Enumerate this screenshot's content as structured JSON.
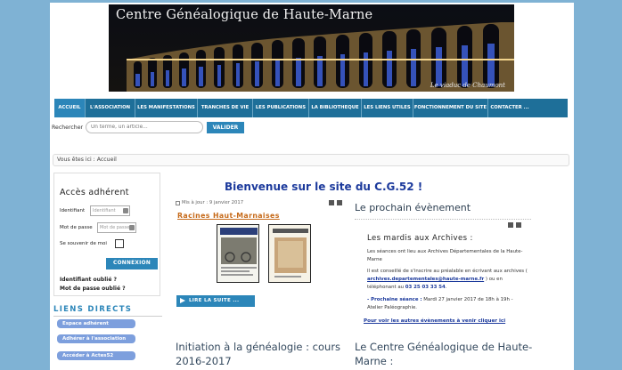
{
  "banner": {
    "title": "Centre Généalogique de Haute-Marne",
    "caption": "Le viaduc de Chaumont"
  },
  "nav": {
    "items": [
      {
        "label": "ACCUEIL",
        "active": true
      },
      {
        "label": "L'ASSOCIATION",
        "active": false
      },
      {
        "label": "LES MANIFESTATIONS",
        "active": false
      },
      {
        "label": "TRANCHES DE VIE",
        "active": false
      },
      {
        "label": "LES PUBLICATIONS",
        "active": false
      },
      {
        "label": "LA BIBLIOTHEQUE",
        "active": false
      },
      {
        "label": "LES LIENS UTILES",
        "active": false
      },
      {
        "label": "FONCTIONNEMENT DU SITE",
        "active": false
      },
      {
        "label": "CONTACTER ...",
        "active": false
      }
    ]
  },
  "search": {
    "label": "Rechercher",
    "placeholder": "Un terme, un article...",
    "button": "VALIDER"
  },
  "breadcrumb": "Vous êtes ici : Accueil",
  "login": {
    "title": "Accès adhérent",
    "id_label": "Identifiant",
    "id_placeholder": "Identifiant",
    "pass_label": "Mot de passe",
    "pass_placeholder": "Mot de passe",
    "remember_label": "Se souvenir de moi",
    "connect": "CONNEXION",
    "forgot_id": "Identifiant oublié ?",
    "forgot_pass": "Mot de passe oublié ?"
  },
  "liens": {
    "title": "LIENS DIRECTS",
    "items": [
      "Espace adhérent",
      "Adhérer à l'association",
      "Accéder à Actes52"
    ]
  },
  "main": {
    "welcome": "Bienvenue sur le site du C.G.52 !",
    "meta": "Mis à jour : 9 janvier 2017",
    "article_link": "Racines Haut-Marnaises",
    "lire": "LIRE LA SUITE ...",
    "init_title": "Initiation à la généalogie : cours 2016-2017"
  },
  "event": {
    "section_title": "Le prochain évènement",
    "heading": "Les mardis aux Archives :",
    "p1": "Les séances ont lieu aux Archives Départementales de la Haute-Marne",
    "p2_a": "Il est conseillé de s'inscrire au préalable en écrivant aux archives ( ",
    "p2_link": "archives.departementales@haute-marne.fr",
    "p2_b": " ) ou en téléphonant au ",
    "p2_tel": "03 25 03 33 54",
    "p2_c": ".",
    "p3_label": "- Prochaine séance :",
    "p3_text": " Mardi 27 janvier 2017 de 18h à 19h - Atelier Paléographie.",
    "more": "Pour voir les autres évènements à venir cliquer ici"
  },
  "cgh_title": "Le Centre Généalogique de Haute-Marne :"
}
